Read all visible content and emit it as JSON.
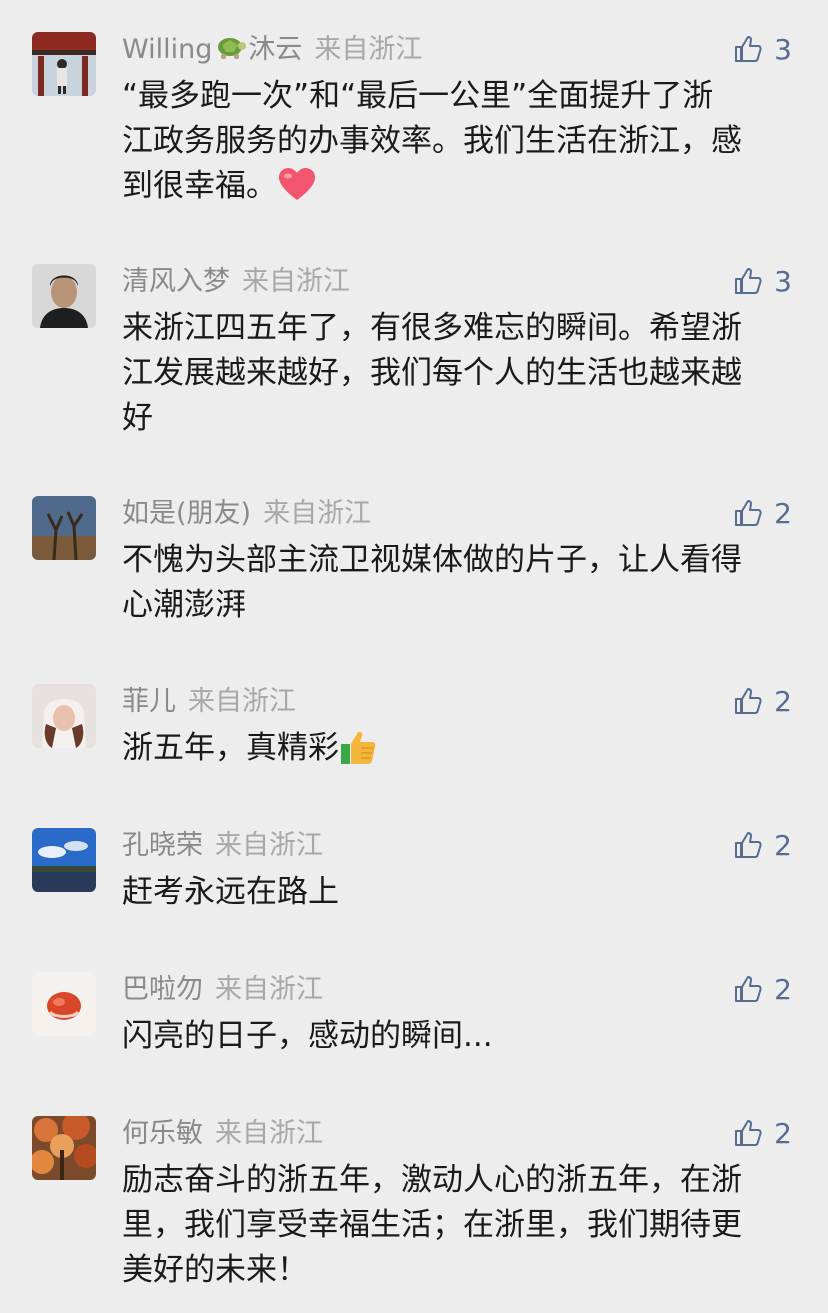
{
  "like_color": "#576b95",
  "comments": [
    {
      "name": "Willing",
      "name_suffix": "沐云",
      "from": "来自浙江",
      "likes": "3",
      "lines": [
        "“最多跑一次”和“最后一公里”全面提升了浙",
        "江政务服务的办事效率。我们生活在浙江，感",
        "到很幸福。"
      ],
      "trailing_emoji": "heart-emoji"
    },
    {
      "name": "清风入梦",
      "from": "来自浙江",
      "likes": "3",
      "lines": [
        "来浙江四五年了，有很多难忘的瞬间。希望浙",
        "江发展越来越好，我们每个人的生活也越来越",
        "好"
      ]
    },
    {
      "name": "如是(朋友)",
      "from": "来自浙江",
      "likes": "2",
      "lines": [
        "不愧为头部主流卫视媒体做的片子，让人看得",
        "心潮澎湃"
      ]
    },
    {
      "name": "菲儿",
      "from": "来自浙江",
      "likes": "2",
      "lines": [
        "浙五年，真精彩"
      ],
      "trailing_emoji": "thumbs-up-emoji"
    },
    {
      "name": "孔晓荣",
      "from": "来自浙江",
      "likes": "2",
      "lines": [
        "赶考永远在路上"
      ]
    },
    {
      "name": "巴啦勿",
      "from": "来自浙江",
      "likes": "2",
      "lines": [
        "闪亮的日子，感动的瞬间..."
      ]
    },
    {
      "name": "何乐敏",
      "from": "来自浙江",
      "likes": "2",
      "lines": [
        "励志奋斗的浙五年，激动人心的浙五年，在浙",
        "里，我们享受幸福生活；在浙里，我们期待更",
        "美好的未来！"
      ]
    }
  ]
}
